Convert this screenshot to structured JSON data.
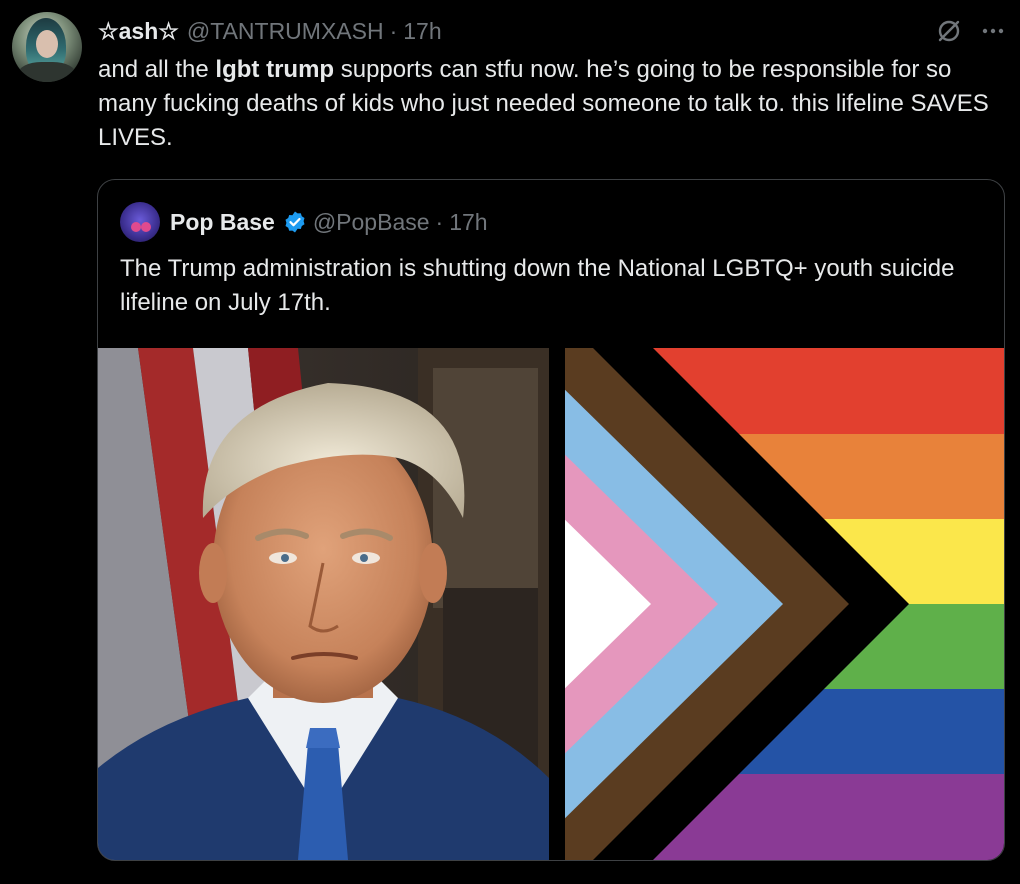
{
  "tweet": {
    "display_name": "☆ash☆",
    "handle": "@TANTRUMXASH",
    "separator": "·",
    "time": "17h",
    "text_parts": [
      "and all the ",
      "lgbt trump",
      " supports can stfu now. he’s going to be responsible for so many fucking deaths of kids who just needed someone to talk to. this lifeline SAVES LIVES."
    ],
    "grok_icon": "grok-icon",
    "more_icon": "more-icon",
    "more_label": "···"
  },
  "quoted_tweet": {
    "display_name": "Pop Base",
    "verified_icon": "verified-badge-icon",
    "verified_color": "#1d9bf0",
    "handle": "@PopBase",
    "separator": "·",
    "time": "17h",
    "text": "The Trump administration is shutting down the National LGBTQ+ youth suicide lifeline on July 17th.",
    "images": [
      {
        "name": "portrait-photo"
      },
      {
        "name": "progress-pride-flag",
        "stripe_colors": [
          "#e2402f",
          "#e8823a",
          "#fbe74b",
          "#5fb04a",
          "#2453a6",
          "#8a3a95"
        ],
        "chevron_colors": [
          "#ffffff",
          "#e597bd",
          "#88bde5",
          "#5a3c20",
          "#000000"
        ]
      }
    ]
  },
  "colors": {
    "background": "#000000",
    "text_primary": "#e7e9ea",
    "text_secondary": "#71767b",
    "border": "#3e4144"
  }
}
